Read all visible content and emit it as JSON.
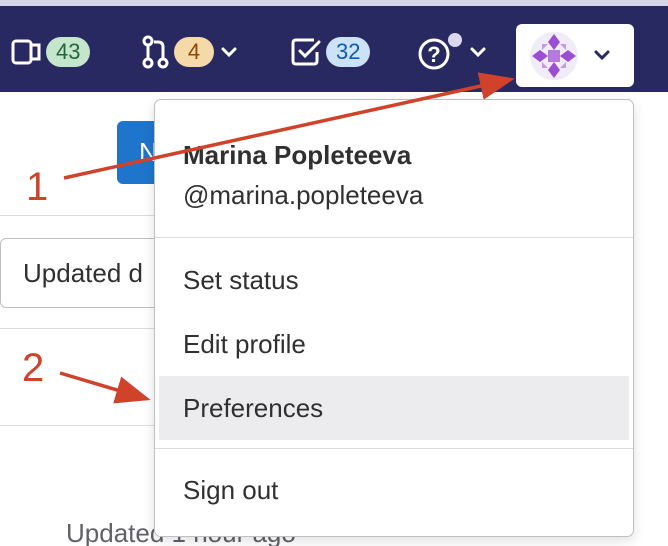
{
  "navbar": {
    "issues_count": "43",
    "merge_requests_count": "4",
    "todos_count": "32"
  },
  "background": {
    "button_text": "N",
    "sort_label": "Updated d",
    "updated_text": "Updated 1 hour ago"
  },
  "user_menu": {
    "name": "Marina Popleteeva",
    "username": "@marina.popleteeva",
    "items": [
      {
        "label": "Set status"
      },
      {
        "label": "Edit profile"
      },
      {
        "label": "Preferences"
      },
      {
        "label": "Sign out"
      }
    ]
  },
  "annotations": {
    "step1": "1",
    "step2": "2"
  },
  "colors": {
    "navbar_bg": "#292961",
    "annotation_red": "#d0422a",
    "highlight_bg": "#ececef"
  },
  "icons": [
    "issues-icon",
    "merge-request-icon",
    "todo-icon",
    "help-icon",
    "chevron-down-icon",
    "avatar-identicon"
  ]
}
